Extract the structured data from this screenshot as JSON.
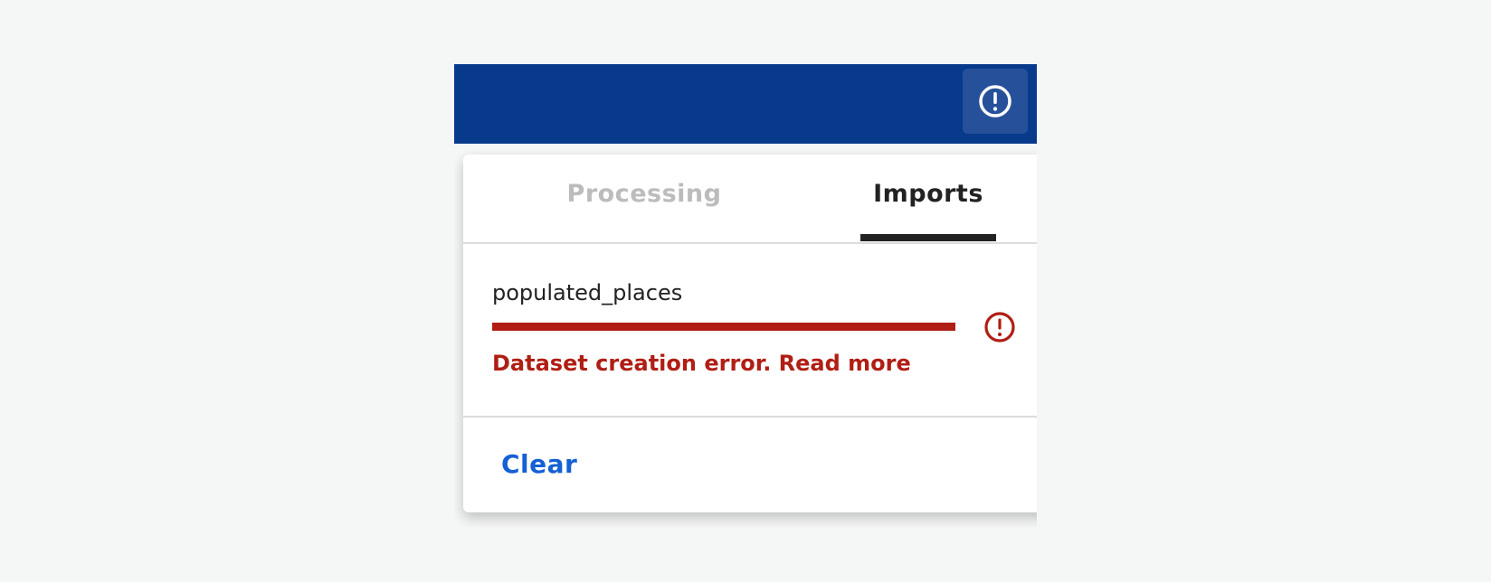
{
  "header": {
    "notification_icon": "alert-circle-icon",
    "background_color": "#083a8c"
  },
  "panel": {
    "tabs": [
      {
        "label": "Processing",
        "active": false
      },
      {
        "label": "Imports",
        "active": true
      }
    ],
    "imports": [
      {
        "name": "populated_places",
        "progress": 1.0,
        "status": "error",
        "status_icon": "alert-circle-icon",
        "message": "Dataset creation error. Read more",
        "error_color": "#b01e14"
      }
    ],
    "clear_label": "Clear",
    "accent_color": "#1560d4"
  }
}
